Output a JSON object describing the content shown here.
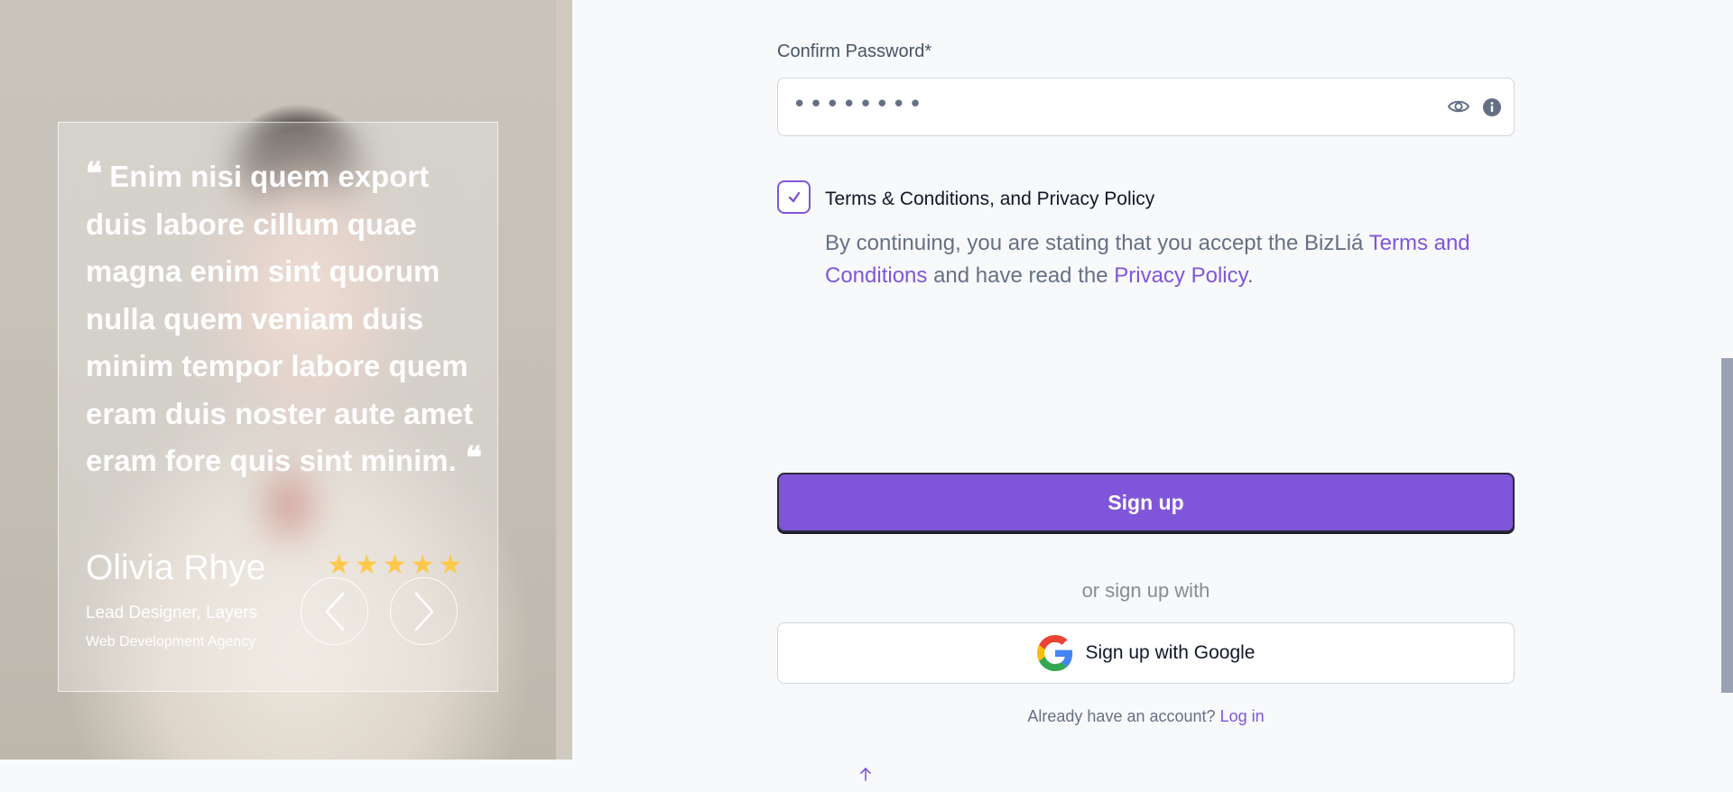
{
  "testimonial": {
    "quote": "Enim nisi quem export duis labore cillum quae magna enim sint quorum nulla quem veniam duis minim tempor labore quem eram duis noster aute amet eram fore quis sint minim.",
    "quote_open": "❝",
    "quote_close": "❝",
    "author_name": "Olivia Rhye",
    "author_role": "Lead Designer, Layers",
    "author_company": "Web Development Agency",
    "rating": 5,
    "star_glyph": "★",
    "star_color": "#fec84b",
    "prev_icon": "chevron-left-icon",
    "next_icon": "chevron-right-icon"
  },
  "form": {
    "confirm_password_label": "Confirm Password*",
    "confirm_password_value": "••••••••",
    "eye_icon": "eye-icon",
    "info_icon": "info-icon",
    "terms_checked": true,
    "terms_title": "Terms & Conditions, and Privacy Policy",
    "terms_text_1": "By continuing, you are stating that you accept the BizLiá ",
    "terms_link": "Terms and Conditions",
    "terms_text_2": " and have read the ",
    "privacy_link": "Privacy Policy",
    "terms_text_3": ".",
    "signup_label": "Sign up",
    "or_text": "or sign up with",
    "google_label": "Sign up with Google",
    "login_prompt": "Already have an account?",
    "login_link": "Log in"
  },
  "colors": {
    "accent": "#7f56d9",
    "page_bg": "#f8f9fb",
    "text_muted": "#667085"
  }
}
